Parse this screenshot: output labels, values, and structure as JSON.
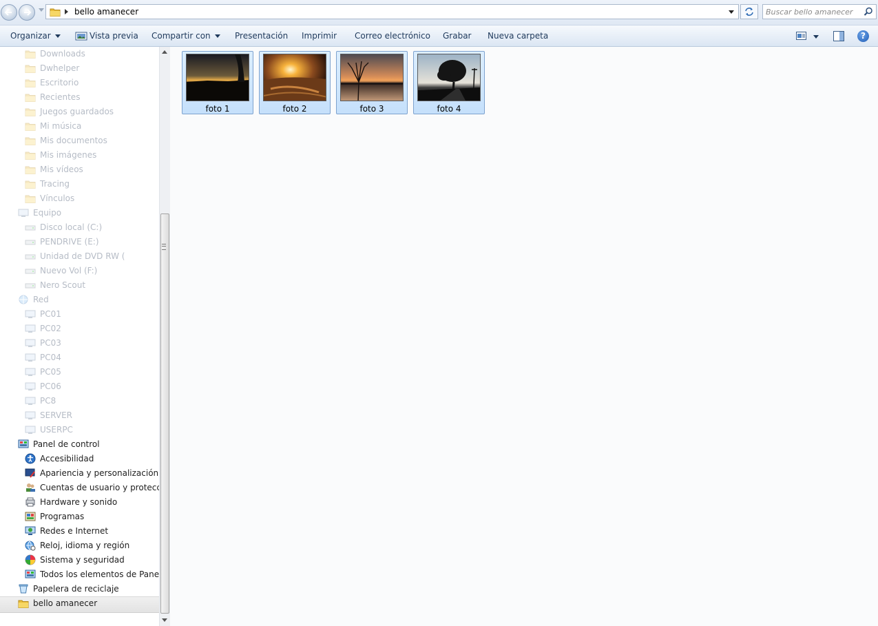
{
  "address_bar": {
    "path": "bello amanecer",
    "search_placeholder": "Buscar bello amanecer"
  },
  "toolbar": {
    "organize": "Organizar",
    "preview": "Vista previa",
    "share": "Compartir con",
    "slideshow": "Presentación",
    "print": "Imprimir",
    "email": "Correo electrónico",
    "burn": "Grabar",
    "new_folder": "Nueva carpeta",
    "help": "?"
  },
  "nav": {
    "faded": [
      "Downloads",
      "Dwhelper",
      "Escritorio",
      "Recientes",
      "Juegos guardados",
      "Mi música",
      "Mis documentos",
      "Mis imágenes",
      "Mis vídeos",
      "Tracing",
      "Vínculos",
      "Equipo",
      "Disco local (C:)",
      "PENDRIVE (E:)",
      "Unidad de DVD RW (",
      "Nuevo Vol (F:)",
      "Nero Scout",
      "Red",
      "PC01",
      "PC02",
      "PC03",
      "PC04",
      "PC05",
      "PC06",
      "PC8",
      "SERVER",
      "USERPC"
    ],
    "control_panel": "Panel de control",
    "control_items": [
      "Accesibilidad",
      "Apariencia y personalización",
      "Cuentas de usuario y protección",
      "Hardware y sonido",
      "Programas",
      "Redes e Internet",
      "Reloj, idioma y región",
      "Sistema y seguridad",
      "Todos los elementos de Panel de"
    ],
    "recycle_bin": "Papelera de reciclaje",
    "selected_folder": "bello amanecer"
  },
  "files": [
    {
      "name": "foto 1",
      "icon": "sunset-photo"
    },
    {
      "name": "foto 2",
      "icon": "sunburst-photo"
    },
    {
      "name": "foto 3",
      "icon": "lake-sunset-photo"
    },
    {
      "name": "foto 4",
      "icon": "tree-silhouette-photo"
    }
  ]
}
